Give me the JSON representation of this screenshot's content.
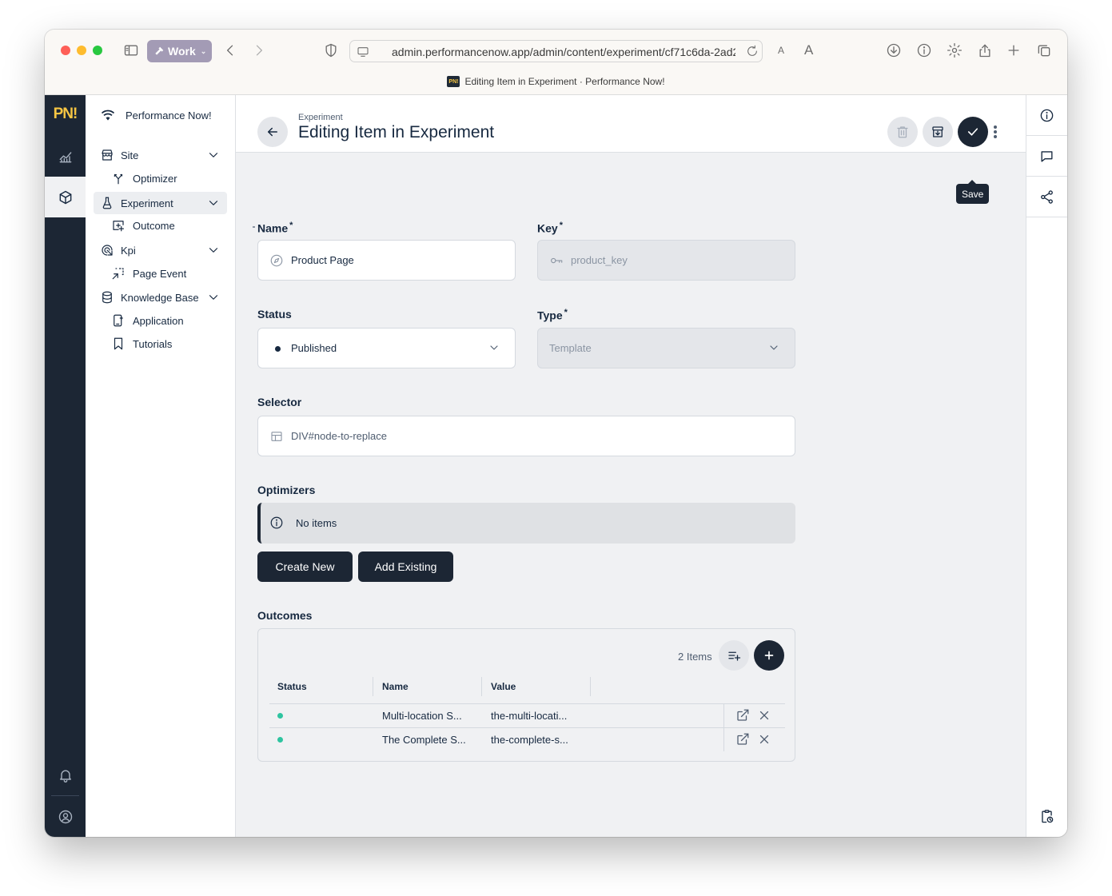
{
  "browser": {
    "profile_label": "Work",
    "url": "admin.performancenow.app/admin/content/experiment/cf71c6da-2ad2",
    "text_size_small": "A",
    "text_size_large": "A",
    "tab_title": "Editing Item in Experiment · Performance Now!",
    "favicon_text": "PN!"
  },
  "app": {
    "logo": "PN!",
    "project_name": "Performance Now!"
  },
  "nav": {
    "items": [
      {
        "label": "Site",
        "icon": "storefront-icon",
        "expanded": true
      },
      {
        "label": "Optimizer",
        "icon": "fork-icon",
        "sub": true
      },
      {
        "label": "Experiment",
        "icon": "flask-icon",
        "expanded": true,
        "active": true
      },
      {
        "label": "Outcome",
        "icon": "screen-add-icon",
        "sub": true
      },
      {
        "label": "Kpi",
        "icon": "target-icon",
        "expanded": true
      },
      {
        "label": "Page Event",
        "icon": "cursor-select-icon",
        "sub": true
      },
      {
        "label": "Knowledge Base",
        "icon": "database-icon",
        "expanded": true
      },
      {
        "label": "Application",
        "icon": "app-icon",
        "sub": true
      },
      {
        "label": "Tutorials",
        "icon": "bookmark-icon",
        "sub": true
      }
    ]
  },
  "header": {
    "breadcrumb": "Experiment",
    "title": "Editing Item in Experiment",
    "save_tooltip": "Save"
  },
  "form": {
    "name": {
      "label": "Name",
      "required": "*",
      "value": "Product Page"
    },
    "key": {
      "label": "Key",
      "required": "*",
      "value": "product_key"
    },
    "status": {
      "label": "Status",
      "value": "Published"
    },
    "type": {
      "label": "Type",
      "required": "*",
      "value": "Template"
    },
    "selector": {
      "label": "Selector",
      "value": "DIV#node-to-replace"
    },
    "optimizers": {
      "label": "Optimizers",
      "empty_text": "No items",
      "create_label": "Create New",
      "add_label": "Add Existing"
    },
    "outcomes": {
      "label": "Outcomes",
      "count_text": "2 Items",
      "columns": [
        "Status",
        "Name",
        "Value"
      ],
      "rows": [
        {
          "status_color": "#2ec4a0",
          "name": "Multi-location S...",
          "value": "the-multi-locati..."
        },
        {
          "status_color": "#2ec4a0",
          "name": "The Complete S...",
          "value": "the-complete-s..."
        }
      ]
    }
  },
  "colors": {
    "accent_dark": "#1c2634",
    "logo_yellow": "#f6c543",
    "status_green": "#2ec4a0"
  }
}
